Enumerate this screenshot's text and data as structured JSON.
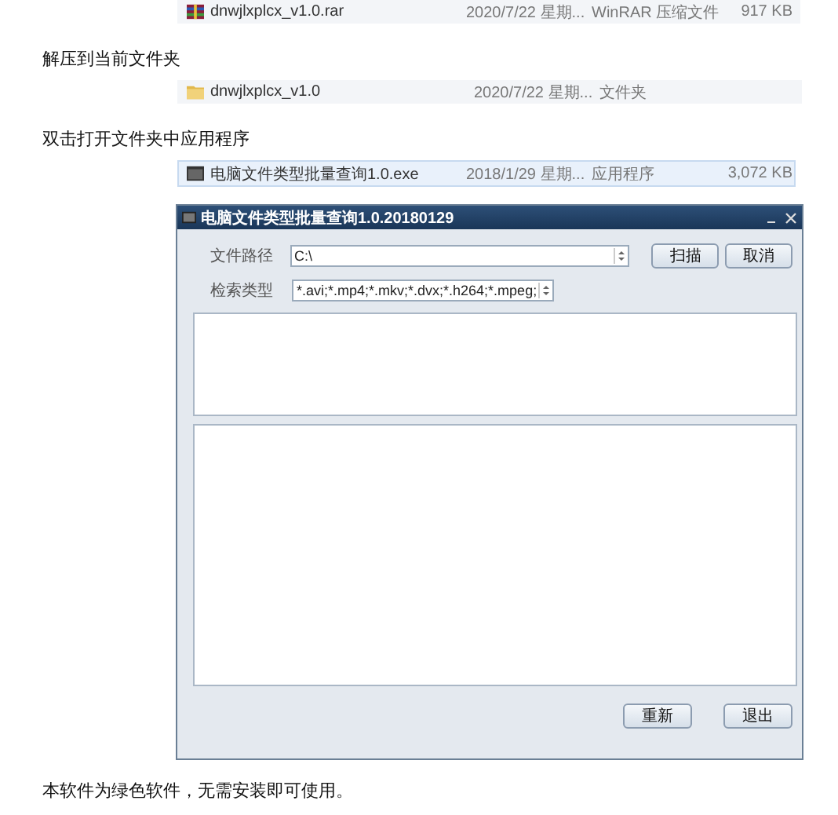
{
  "blocks": [
    {
      "kind": "archive",
      "selected": false,
      "name": "dnwjlxplcx_v1.0.rar",
      "date": "2020/7/22 星期...",
      "type": "WinRAR 压缩文件",
      "size": "917 KB"
    },
    {
      "kind": "text",
      "text": "解压到当前文件夹"
    },
    {
      "kind": "folder",
      "selected": false,
      "name": "dnwjlxplcx_v1.0",
      "date": "2020/7/22 星期...",
      "type": "文件夹"
    },
    {
      "kind": "text",
      "text": "双击打开文件夹中应用程序"
    },
    {
      "kind": "program",
      "selected": true,
      "name": "电脑文件类型批量查询1.0.exe",
      "date": "2018/1/29 星期...",
      "type": "应用程序",
      "size": "3,072 KB"
    },
    {
      "kind": "window",
      "title": "电脑文件类型批量查询1.0.20180129",
      "fields": [
        {
          "label": "文件路径",
          "value": "C:\\"
        },
        {
          "label": "检索类型",
          "value": "*.avi;*.mp4;*.mkv;*.dvx;*.h264;*.mpeg;"
        }
      ],
      "top_buttons": [
        "扫描",
        "取消"
      ],
      "bottom_buttons": [
        "重新",
        "退出"
      ]
    },
    {
      "kind": "text",
      "text": "本软件为绿色软件，无需安装即可使用。"
    }
  ]
}
